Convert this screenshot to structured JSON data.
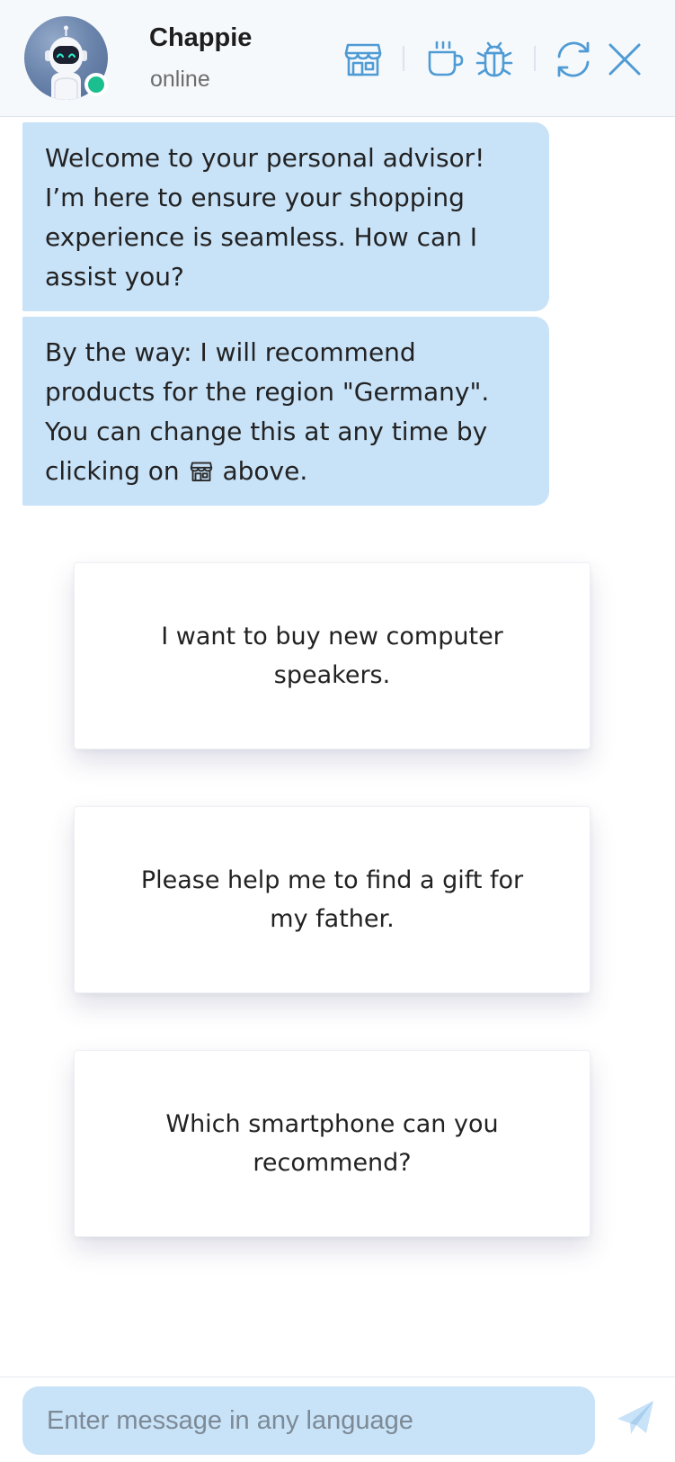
{
  "header": {
    "name": "Chappie",
    "status": "online",
    "icons": [
      "store-icon",
      "coffee-icon",
      "bug-icon",
      "refresh-icon",
      "close-icon"
    ]
  },
  "colors": {
    "accent": "#4f9bd5",
    "bubble": "#c8e2f8",
    "online": "#1bbf8f"
  },
  "messages": [
    {
      "text": "Welcome to your personal advisor! I’m here to ensure your shopping experience is seamless. How can I assist you?"
    },
    {
      "text_before": "By the way: I will recommend products for the region \"Germany\". You can change this at any time by clicking on",
      "text_after": "above."
    }
  ],
  "suggestions": [
    "I want to buy new computer speakers.",
    "Please help me to find a gift for my father.",
    "Which smartphone can you recommend?"
  ],
  "composer": {
    "placeholder": "Enter message in any language"
  }
}
